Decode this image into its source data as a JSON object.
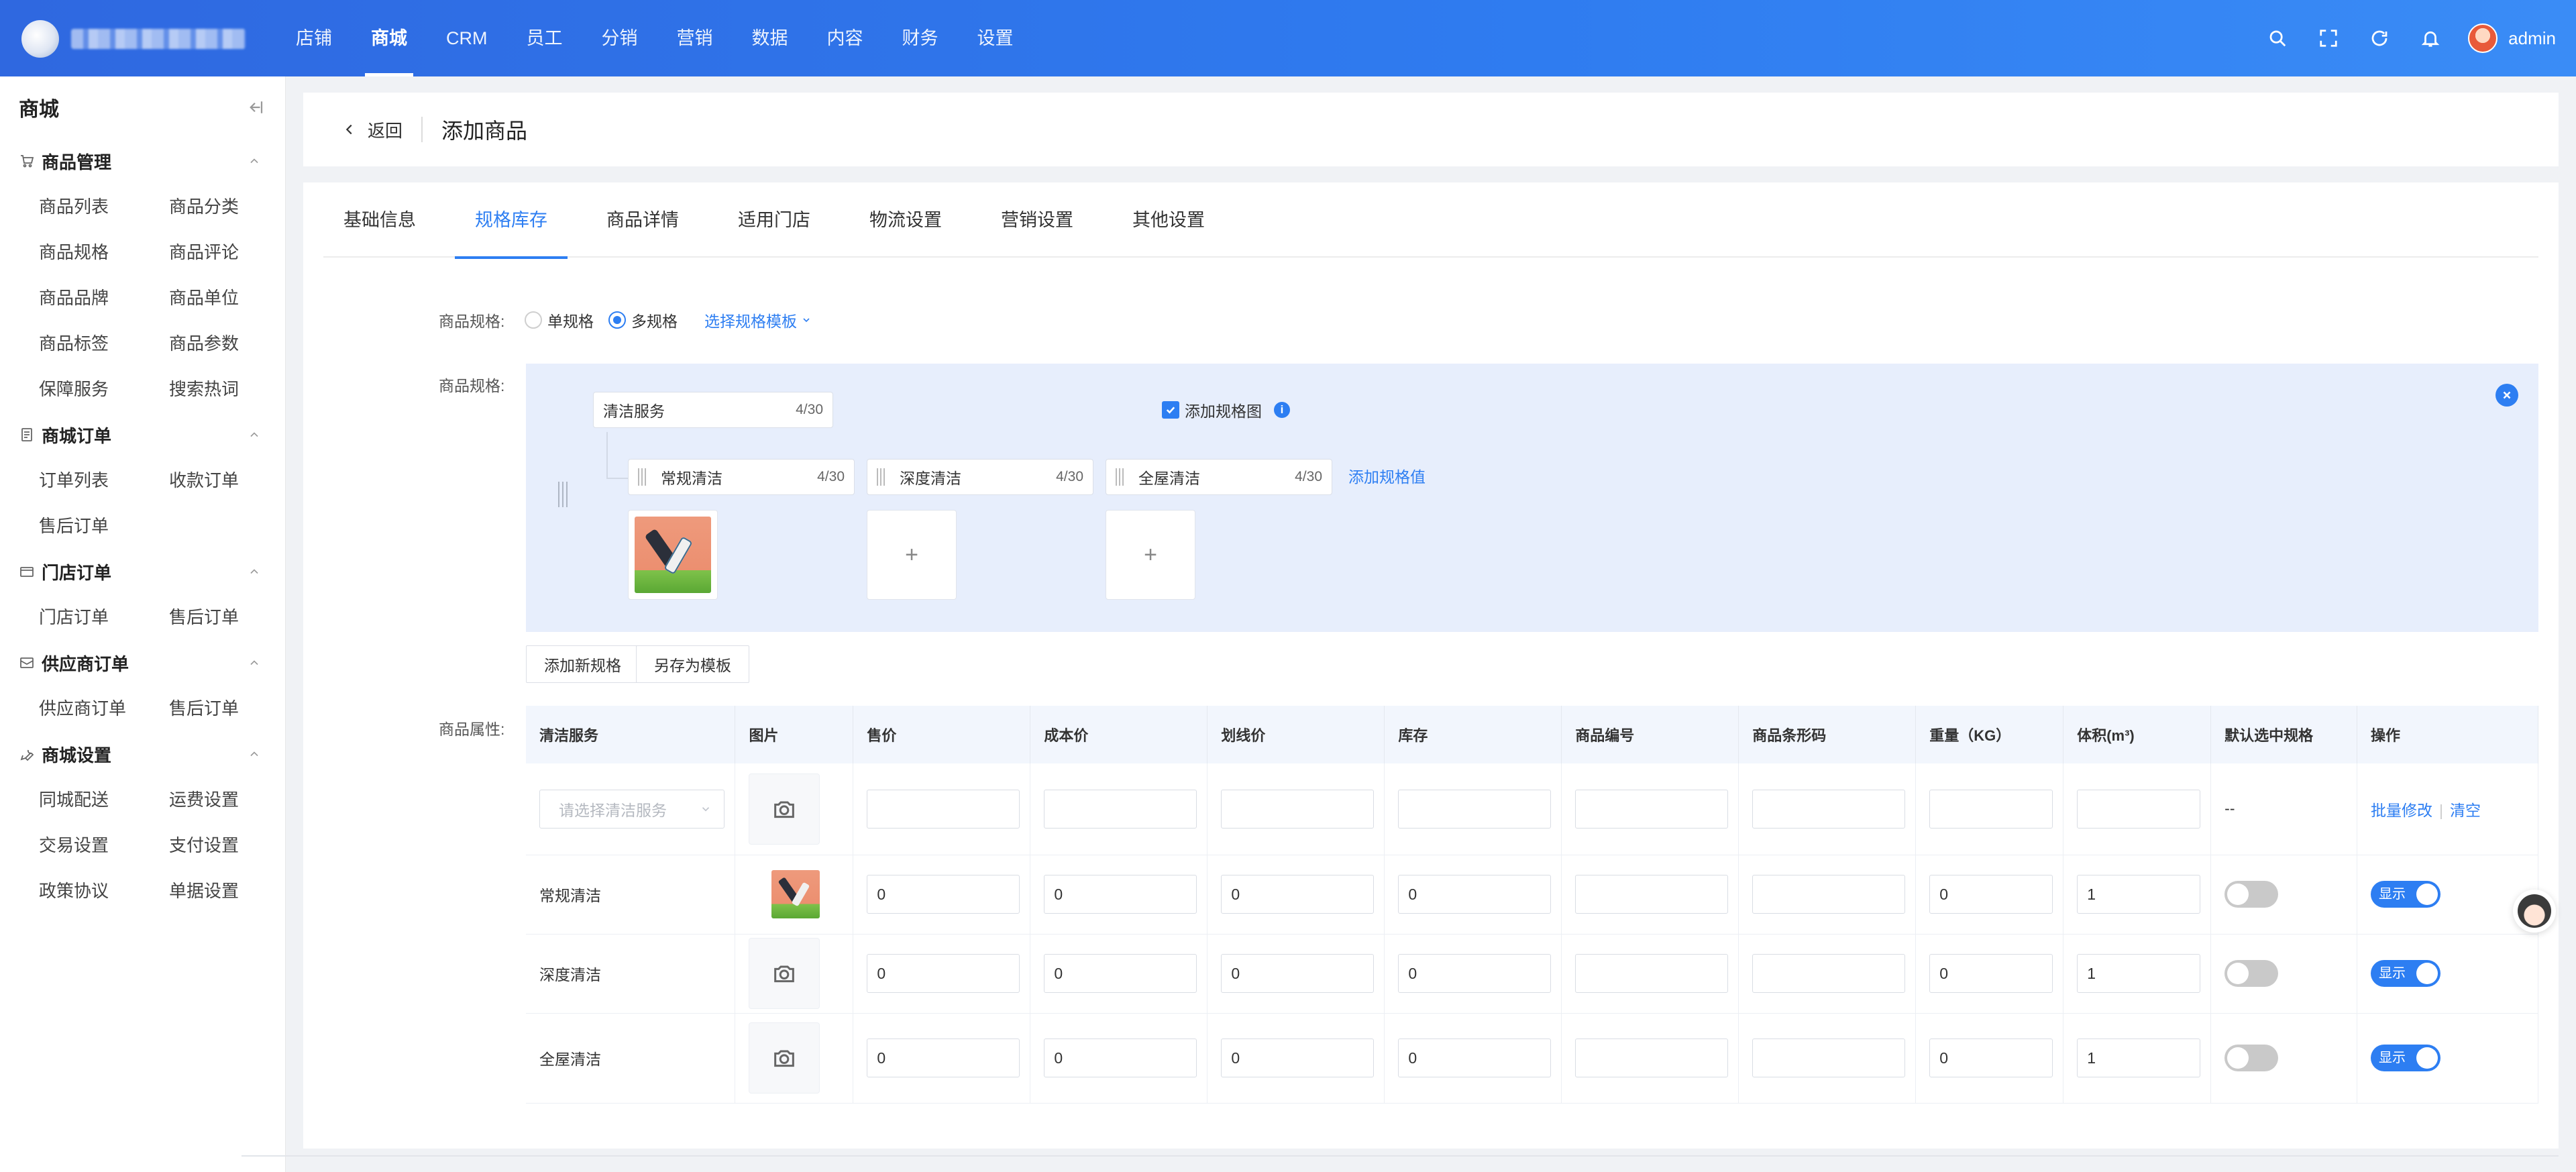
{
  "topnav": {
    "items": [
      "店铺",
      "商城",
      "CRM",
      "员工",
      "分销",
      "营销",
      "数据",
      "内容",
      "财务",
      "设置"
    ],
    "active_index": 1,
    "user": "admin"
  },
  "sidebar": {
    "title": "商城",
    "groups": [
      {
        "name": "商品管理",
        "icon": "cart-icon",
        "items": [
          "商品列表",
          "商品分类",
          "商品规格",
          "商品评论",
          "商品品牌",
          "商品单位",
          "商品标签",
          "商品参数",
          "保障服务",
          "搜索热词"
        ]
      },
      {
        "name": "商城订单",
        "icon": "order-icon",
        "items": [
          "订单列表",
          "收款订单",
          "售后订单"
        ]
      },
      {
        "name": "门店订单",
        "icon": "store-icon",
        "items": [
          "门店订单",
          "售后订单"
        ]
      },
      {
        "name": "供应商订单",
        "icon": "supplier-icon",
        "items": [
          "供应商订单",
          "售后订单"
        ]
      },
      {
        "name": "商城设置",
        "icon": "wrench-icon",
        "items": [
          "同城配送",
          "运费设置",
          "交易设置",
          "支付设置",
          "政策协议",
          "单据设置"
        ]
      }
    ]
  },
  "header": {
    "back_label": "返回",
    "title": "添加商品"
  },
  "tabs": [
    "基础信息",
    "规格库存",
    "商品详情",
    "适用门店",
    "物流设置",
    "营销设置",
    "其他设置"
  ],
  "active_tab": 1,
  "spec_type": {
    "label": "商品规格:",
    "options": [
      "单规格",
      "多规格"
    ],
    "selected": 1,
    "template_link": "选择规格模板"
  },
  "spec_editor": {
    "label": "商品规格:",
    "group_name": {
      "value": "清洁服务",
      "count": "4/30"
    },
    "add_image_label": "添加规格图",
    "values": [
      {
        "value": "常规清洁",
        "count": "4/30",
        "has_image": true
      },
      {
        "value": "深度清洁",
        "count": "4/30",
        "has_image": false
      },
      {
        "value": "全屋清洁",
        "count": "4/30",
        "has_image": false
      }
    ],
    "add_value_label": "添加规格值",
    "plus": "+"
  },
  "buttons": {
    "add_spec": "添加新规格",
    "save_template": "另存为模板"
  },
  "attr_table": {
    "label": "商品属性:",
    "columns": [
      "清洁服务",
      "图片",
      "售价",
      "成本价",
      "划线价",
      "库存",
      "商品编号",
      "商品条形码",
      "重量（KG）",
      "体积(m³)",
      "默认选中规格",
      "操作"
    ],
    "batch_row": {
      "select_placeholder": "请选择清洁服务",
      "default_spec": "--",
      "batch_edit": "批量修改",
      "clear": "清空"
    },
    "rows": [
      {
        "name": "常规清洁",
        "has_image": true,
        "price": "0",
        "cost": "0",
        "line_price": "0",
        "stock": "0",
        "sku": "",
        "barcode": "",
        "weight": "0",
        "volume": "1",
        "default": false,
        "show": "显示"
      },
      {
        "name": "深度清洁",
        "has_image": false,
        "price": "0",
        "cost": "0",
        "line_price": "0",
        "stock": "0",
        "sku": "",
        "barcode": "",
        "weight": "0",
        "volume": "1",
        "default": false,
        "show": "显示"
      },
      {
        "name": "全屋清洁",
        "has_image": false,
        "price": "0",
        "cost": "0",
        "line_price": "0",
        "stock": "0",
        "sku": "",
        "barcode": "",
        "weight": "0",
        "volume": "1",
        "default": false,
        "show": "显示"
      }
    ]
  },
  "colors": {
    "primary": "#2d7ef2",
    "topbar": "#2f6fe6",
    "panel": "#e7eefc"
  }
}
